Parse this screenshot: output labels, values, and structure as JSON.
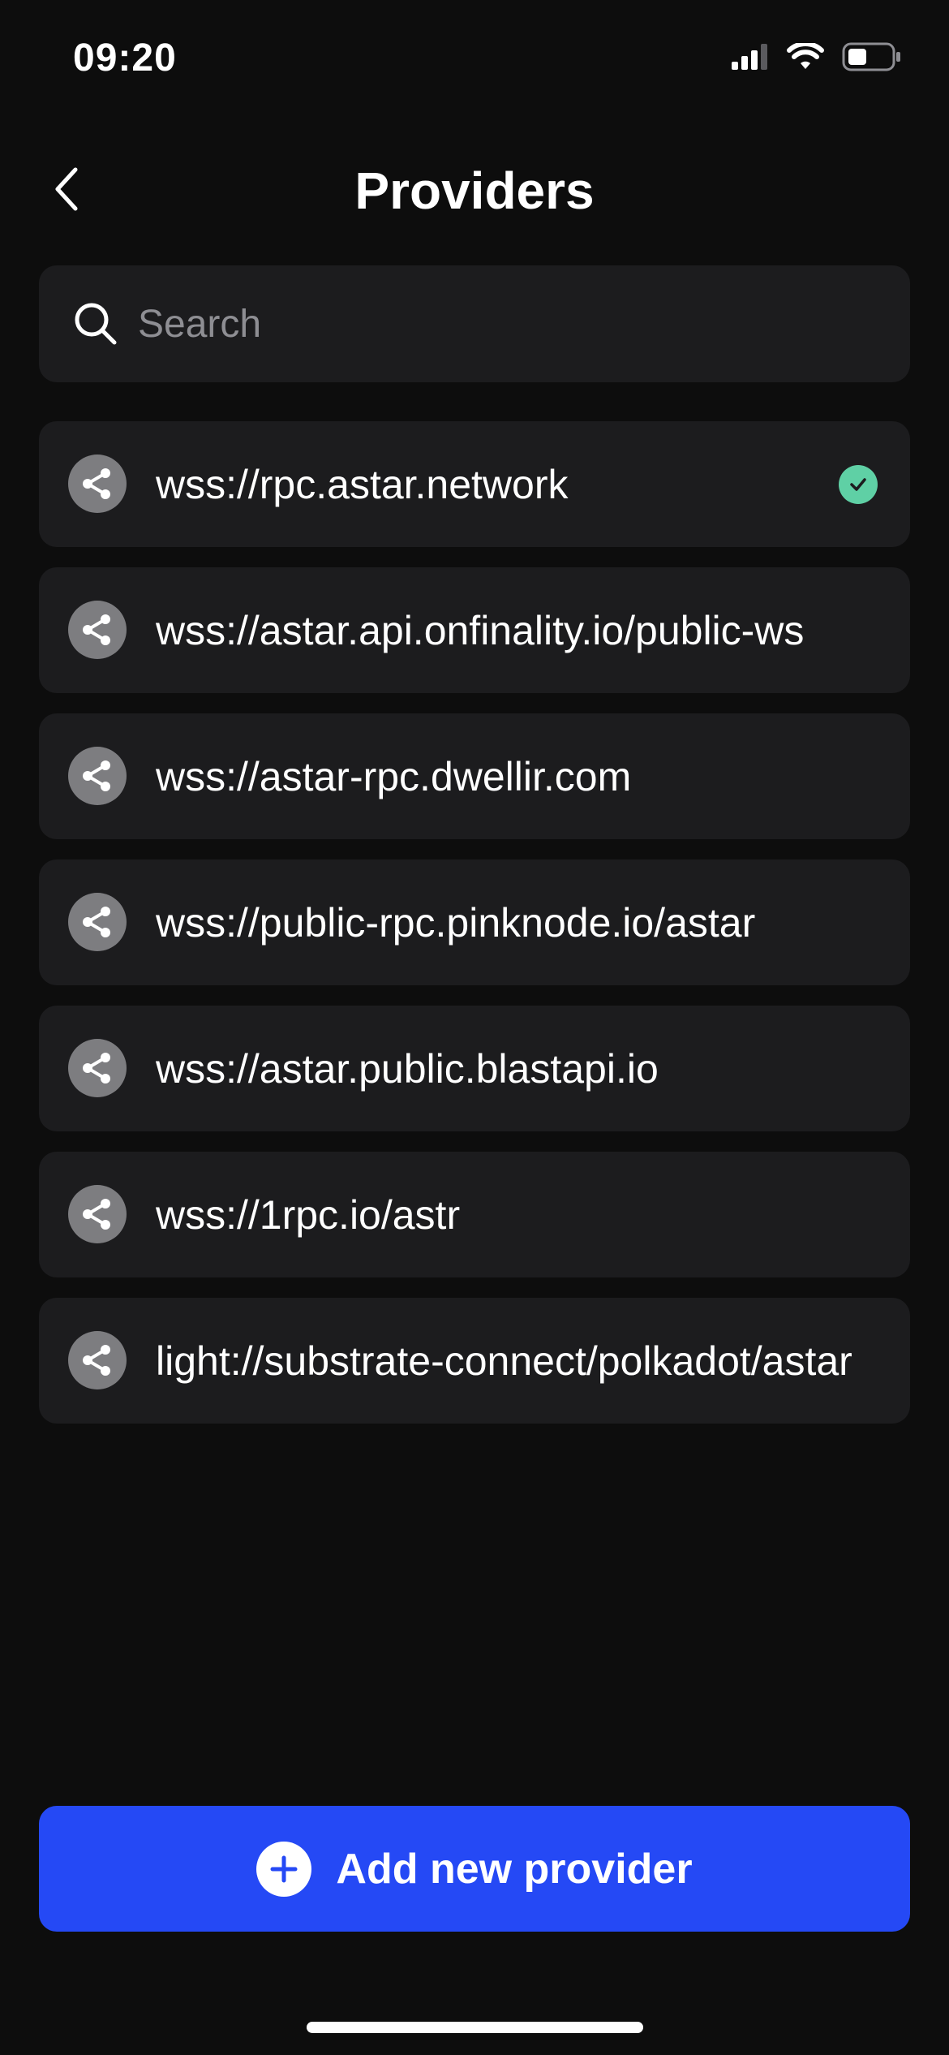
{
  "status_bar": {
    "time": "09:20",
    "icons": [
      "cellular-signal-icon",
      "wifi-icon",
      "battery-icon"
    ]
  },
  "header": {
    "title": "Providers",
    "back_icon": "chevron-left-icon"
  },
  "search": {
    "placeholder": "Search",
    "value": "",
    "icon": "search-icon"
  },
  "providers": [
    {
      "url": "wss://rpc.astar.network",
      "selected": true
    },
    {
      "url": "wss://astar.api.onfinality.io/public-ws",
      "selected": false
    },
    {
      "url": "wss://astar-rpc.dwellir.com",
      "selected": false
    },
    {
      "url": "wss://public-rpc.pinknode.io/astar",
      "selected": false
    },
    {
      "url": "wss://astar.public.blastapi.io",
      "selected": false
    },
    {
      "url": "wss://1rpc.io/astr",
      "selected": false
    },
    {
      "url": "light://substrate-connect/polkadot/astar",
      "selected": false
    }
  ],
  "add_button": {
    "label": "Add new provider",
    "icon": "plus-circle-icon"
  },
  "colors": {
    "background": "#0d0d0d",
    "card": "#1c1c1e",
    "accent": "#2549f5",
    "check": "#5fd0a5",
    "icon_bg": "#7d7d80",
    "placeholder": "#8e8e93"
  }
}
